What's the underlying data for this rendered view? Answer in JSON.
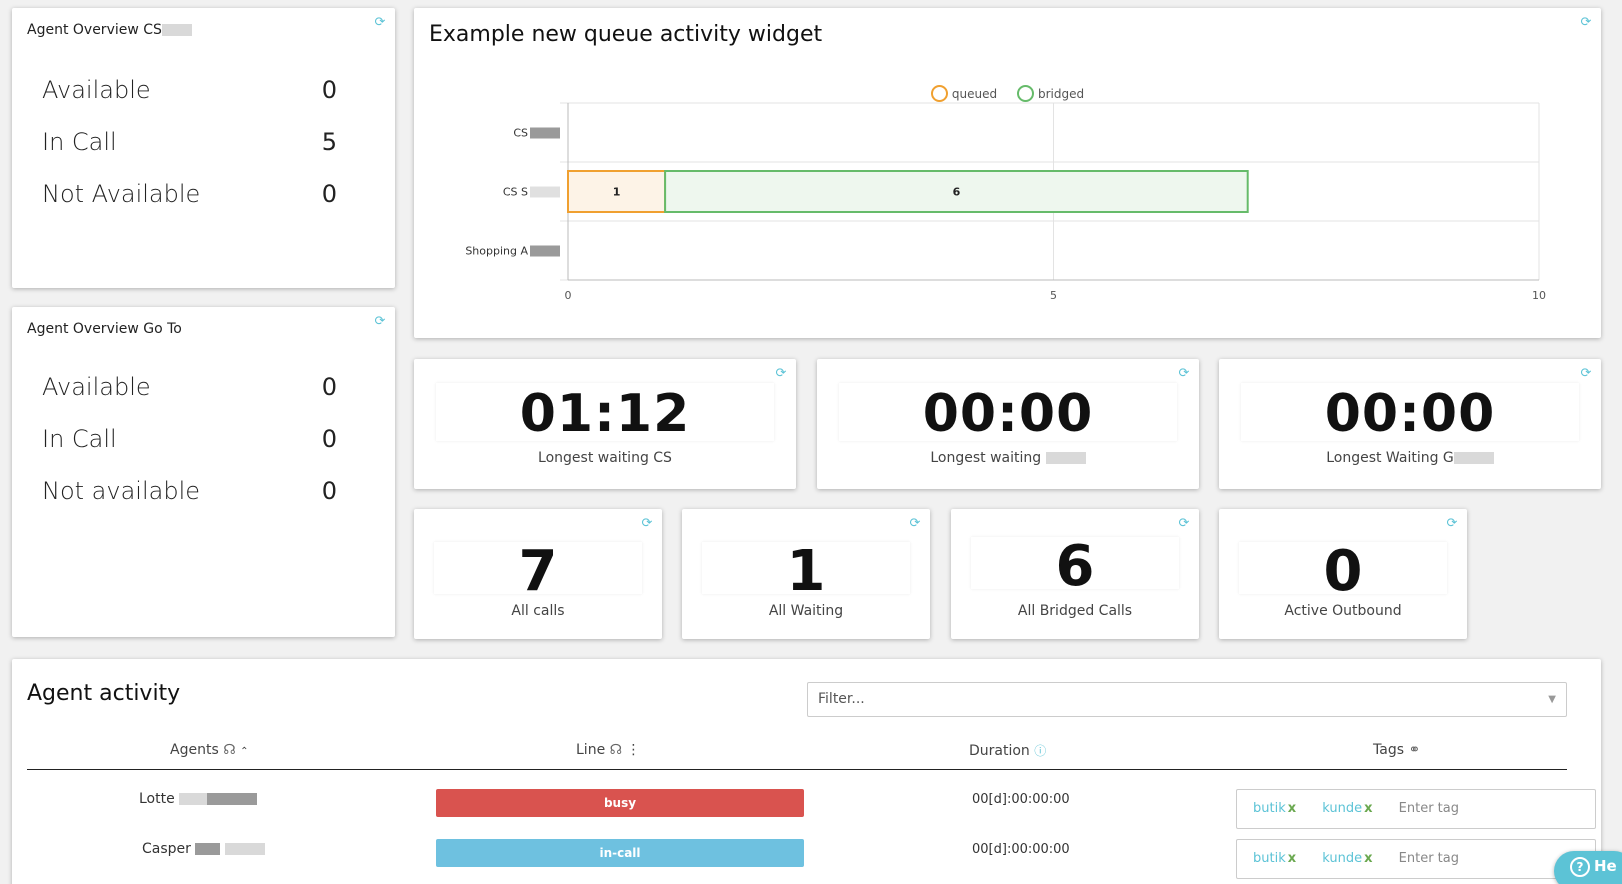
{
  "overview_cs": {
    "title": "Agent Overview CS",
    "rows": [
      {
        "label": "Available",
        "value": "0"
      },
      {
        "label": "In Call",
        "value": "5"
      },
      {
        "label": "Not Available",
        "value": "0"
      }
    ]
  },
  "overview_go": {
    "title": "Agent Overview Go To",
    "rows": [
      {
        "label": "Available",
        "value": "0"
      },
      {
        "label": "In Call",
        "value": "0"
      },
      {
        "label": "Not available",
        "value": "0"
      }
    ]
  },
  "queue_widget": {
    "title": "Example new queue activity widget"
  },
  "chart_data": {
    "type": "bar",
    "orientation": "horizontal",
    "stacked": true,
    "categories": [
      "CS",
      "CS S",
      "Shopping A"
    ],
    "series": [
      {
        "name": "queued",
        "values": [
          0,
          1,
          0
        ],
        "color": "#f0a030"
      },
      {
        "name": "bridged",
        "values": [
          0,
          6,
          0
        ],
        "color": "#66bb6a"
      }
    ],
    "data_labels": [
      "1",
      "6"
    ],
    "xlim": [
      0,
      10
    ],
    "x_ticks": [
      "0",
      "5",
      "10"
    ],
    "grid": true,
    "legend_position": "top"
  },
  "timers": [
    {
      "value": "01:12",
      "label": "Longest waiting CS"
    },
    {
      "value": "00:00",
      "label": "Longest waiting"
    },
    {
      "value": "00:00",
      "label": "Longest Waiting G"
    }
  ],
  "counters": [
    {
      "value": "7",
      "label": "All calls"
    },
    {
      "value": "1",
      "label": "All Waiting"
    },
    {
      "value": "6",
      "label": "All Bridged Calls"
    },
    {
      "value": "0",
      "label": "Active Outbound"
    }
  ],
  "activity": {
    "title": "Agent activity",
    "filter_placeholder": "Filter...",
    "columns": {
      "agents": "Agents",
      "line": "Line",
      "duration": "Duration",
      "tags": "Tags"
    },
    "rows": [
      {
        "name": "Lotte",
        "status": "busy",
        "status_color": "#d9534f",
        "duration": "00[d]:00:00:00",
        "tags": [
          "butik",
          "kunde"
        ],
        "tag_placeholder": "Enter tag"
      },
      {
        "name": "Casper",
        "status": "in-call",
        "status_color": "#6ec1e0",
        "duration": "00[d]:00:00:00",
        "tags": [
          "butik",
          "kunde"
        ],
        "tag_placeholder": "Enter tag"
      }
    ]
  },
  "help": {
    "label": "He"
  },
  "icons": {
    "refresh": "refresh-icon",
    "headset": "headset-icon",
    "sort": "sort-asc-icon",
    "info": "info-icon",
    "tag": "tag-icon",
    "menu": "vertical-dots-icon",
    "caret": "chevron-down-icon",
    "help": "help-icon"
  }
}
